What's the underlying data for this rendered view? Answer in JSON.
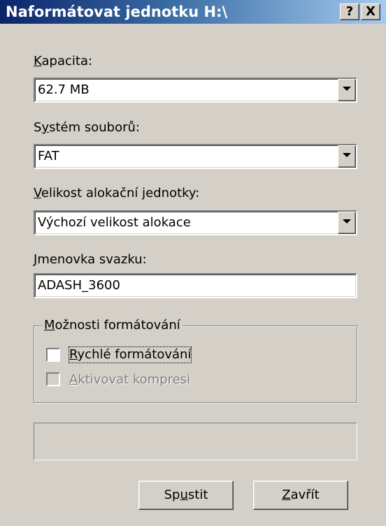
{
  "window": {
    "title": "Naformátovat jednotku H:\\",
    "help_button": "?",
    "close_button": "X"
  },
  "capacity": {
    "label_first": "K",
    "label_rest": "apacita:",
    "value": "62.7 MB"
  },
  "filesystem": {
    "label_pre": "S",
    "label_ul": "y",
    "label_post": "stém souborů:",
    "value": "FAT"
  },
  "allocation": {
    "label_first": "V",
    "label_rest": "elikost alokační jednotky:",
    "value": "Výchozí velikost alokace"
  },
  "volume_label": {
    "label_first": "J",
    "label_rest": "menovka svazku:",
    "value": "ADASH_3600"
  },
  "options": {
    "title_first": "M",
    "title_rest": "ožnosti formátování",
    "quick_format_first": "R",
    "quick_format_rest": "ychlé formátování",
    "quick_format_checked": false,
    "compression_first": "A",
    "compression_rest": "ktivovat kompresi",
    "compression_enabled": false
  },
  "buttons": {
    "start_pre": "Sp",
    "start_ul": "u",
    "start_post": "stit",
    "close_first": "Z",
    "close_rest": "avřít"
  }
}
